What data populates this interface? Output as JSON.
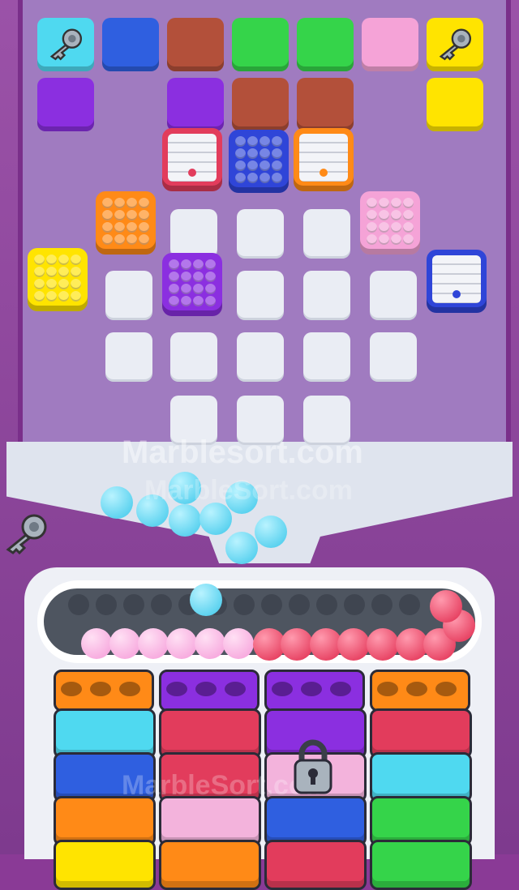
{
  "watermark": {
    "main": "Marblesort.com",
    "small": "MarbleSort.com"
  },
  "colors": {
    "cyan": "#4fd9f0",
    "blue": "#2f5fe0",
    "brown": "#b3503a",
    "green": "#35d44a",
    "pink": "#f5a3d7",
    "yellow": "#ffe400",
    "purple": "#8b2fe0",
    "orange": "#ff8a17",
    "red": "#e23c5c",
    "white": "#f3f4f8"
  },
  "top_row": [
    "cyan-key",
    "blue",
    "brown",
    "green",
    "green",
    "pink",
    "yellow-key"
  ],
  "second_row": [
    "purple",
    "",
    "purple",
    "brown",
    "brown",
    "",
    "yellow"
  ],
  "balls_on_belt": {
    "cyan": 1,
    "pink": 6,
    "red": 9
  },
  "locked_bins": 1
}
